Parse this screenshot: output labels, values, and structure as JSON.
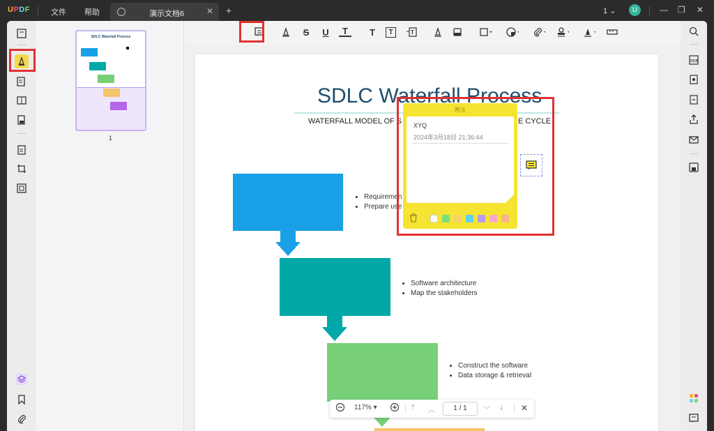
{
  "app": {
    "logo": "UPDF"
  },
  "menu": {
    "file": "文件",
    "help": "帮助"
  },
  "tab": {
    "title": "演示文档6",
    "close": "✕"
  },
  "titlebar": {
    "page_count": "1",
    "avatar": "U"
  },
  "thumbnail": {
    "page_number": "1",
    "mini_title": "SDLC Waterfall Process"
  },
  "document": {
    "title": "SDLC Waterfall Process",
    "subtitle": "WATERFALL MODEL OF S",
    "subtitle_tail": "E CYCLE",
    "step1_bullets": [
      "Requiremen",
      "Prepare use"
    ],
    "step2_bullets": [
      "Software architecture",
      "Map the stakeholders"
    ],
    "step3_bullets": [
      "Construct the software",
      "Data storage & retrieval"
    ]
  },
  "note": {
    "header": "附注",
    "author": "XYQ",
    "date": "2024年3月18日 21:36:44",
    "text": "",
    "swatch_colors": [
      "#ffffff",
      "#7be07b",
      "#f5d36b",
      "#5fd0f2",
      "#b79cf2",
      "#f7a8c8",
      "#f7b48a"
    ]
  },
  "zoom": {
    "level": "117%",
    "page_current": "1",
    "page_total": "1"
  },
  "colors": {
    "step1": "#1aa0e6",
    "step2": "#00a8a8",
    "step3": "#77d077",
    "step4": "#f5c46b",
    "highlight": "#e03131",
    "note": "#f5e431",
    "accent": "#f2b134"
  }
}
